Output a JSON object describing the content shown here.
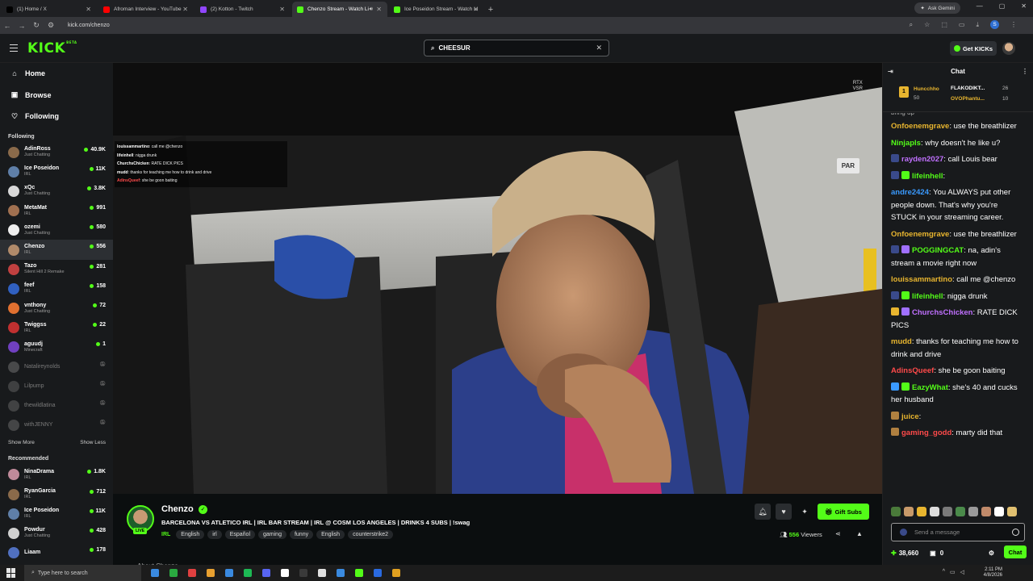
{
  "browser": {
    "tabs": [
      {
        "title": "(1) Home / X",
        "fav": "#000000"
      },
      {
        "title": "Afroman Interview - YouTube",
        "fav": "#ff0000"
      },
      {
        "title": "(2) Kotton - Twitch",
        "fav": "#9146ff"
      },
      {
        "title": "Chenzo Stream - Watch Li",
        "fav": "#53fc18",
        "active": true
      },
      {
        "title": "Ice Poseidon Stream - Watch Li",
        "fav": "#53fc18"
      }
    ],
    "ask_gemini": "Ask Gemini",
    "url": "kick.com/chenzo",
    "profile_initial": "S"
  },
  "header": {
    "logo": "KICK",
    "logo_sup": "BETA",
    "search_value": "CHEESUR",
    "get_kicks": "Get KICKs"
  },
  "sidebar": {
    "nav": [
      {
        "label": "Home",
        "icon": "home-icon",
        "glyph": "⌂"
      },
      {
        "label": "Browse",
        "icon": "browse-icon",
        "glyph": "▣"
      },
      {
        "label": "Following",
        "icon": "heart-icon",
        "glyph": "♡"
      }
    ],
    "following_heading": "Following",
    "following": [
      {
        "name": "AdinRoss",
        "cat": "Just Chatting",
        "viewers": "40.9K",
        "color": "#8a6a4a"
      },
      {
        "name": "Ice Poseidon",
        "cat": "IRL",
        "viewers": "11K",
        "color": "#5f7fa8"
      },
      {
        "name": "xQc",
        "cat": "Just Chatting",
        "viewers": "3.8K",
        "color": "#d8d8d8"
      },
      {
        "name": "MetaMat",
        "cat": "IRL",
        "viewers": "991",
        "color": "#a07050"
      },
      {
        "name": "ozemi",
        "cat": "Just Chatting",
        "viewers": "580",
        "color": "#eeeeee"
      },
      {
        "name": "Chenzo",
        "cat": "IRL",
        "viewers": "556",
        "color": "#b08a6a",
        "selected": true
      },
      {
        "name": "Tazo",
        "cat": "Silent Hill 2 Remake",
        "viewers": "281",
        "color": "#c04040"
      },
      {
        "name": "feef",
        "cat": "IRL",
        "viewers": "158",
        "color": "#3060c0"
      },
      {
        "name": "vnthony",
        "cat": "Just Chatting",
        "viewers": "72",
        "color": "#e07030"
      },
      {
        "name": "Twiggss",
        "cat": "IRL",
        "viewers": "22",
        "color": "#c03030"
      },
      {
        "name": "aguudj",
        "cat": "Minecraft",
        "viewers": "1",
        "color": "#7040c0"
      }
    ],
    "offline": [
      {
        "name": "Natalireynolds",
        "color": "#777777"
      },
      {
        "name": "Lilpump",
        "color": "#666666"
      },
      {
        "name": "thewildlatina",
        "color": "#6a6a6a"
      },
      {
        "name": "withJENNY",
        "color": "#707070"
      }
    ],
    "show_more": "Show More",
    "show_less": "Show Less",
    "recommended_heading": "Recommended",
    "recommended": [
      {
        "name": "NinaDrama",
        "cat": "IRL",
        "viewers": "1.8K",
        "color": "#c08a9a"
      },
      {
        "name": "RyanGarcia",
        "cat": "IRL",
        "viewers": "712",
        "color": "#8a6a4a"
      },
      {
        "name": "Ice Poseidon",
        "cat": "IRL",
        "viewers": "11K",
        "color": "#5f7fa8"
      },
      {
        "name": "Powdur",
        "cat": "Just Chatting",
        "viewers": "428",
        "color": "#d0d0d0"
      },
      {
        "name": "Liaam",
        "cat": "",
        "viewers": "178",
        "color": "#5070c0"
      }
    ]
  },
  "video": {
    "overlay_chat": [
      {
        "user": "louissammartino",
        "text": ": call me @chenzo",
        "color": "#ffffff"
      },
      {
        "user": "lifeinhell",
        "text": ": nigga drunk",
        "color": "#ffffff"
      },
      {
        "user": "ChurchsChicken",
        "text": ": RATE DICK PICS",
        "color": "#ffffff"
      },
      {
        "user": "mudd",
        "text": ": thanks for teaching me how to drink and drive",
        "color": "#ffffff"
      },
      {
        "user": "AdinsQueef",
        "text": ": she be goon baiting",
        "color": "#ff4a4a"
      }
    ],
    "rtx": "RTX",
    "vsr": "VSR",
    "park_sign": "PAR"
  },
  "stream": {
    "channel": "Chenzo",
    "live": "LIVE",
    "title": "BARCELONA VS ATLETICO IRL | IRL BAR STREAM | IRL @ COSM LOS ANGELES | DRINKS 4 SUBS | !swag",
    "category": "IRL",
    "tags": [
      "English",
      "irl",
      "Español",
      "gaming",
      "funny",
      "English",
      "counterstrike2"
    ],
    "gift_subs": "Gift Subs",
    "viewers_count": "556",
    "viewers_label": "Viewers",
    "about": "About Chenzo"
  },
  "chat": {
    "title": "Chat",
    "leaderboard": {
      "rank": "1",
      "first_name": "Huncchho",
      "first_val": "50",
      "second_name": "FLAKODIKT...",
      "second_val": "26",
      "third_name": "OVOPhantu...",
      "third_val": "10"
    },
    "messages": [
      {
        "user": "",
        "text": "bring up",
        "color": "#aaaaaa",
        "partial": true
      },
      {
        "user": "Onfoenemgrave",
        "text": ": use the breathlizer",
        "color": "#e8b52f"
      },
      {
        "user": "Ninjapls",
        "text": ": why doesn't he like u?",
        "color": "#53fc18"
      },
      {
        "user": "rayden2027",
        "text": ": call Louis bear",
        "color": "#c070ff",
        "badge": "#3a4a8a"
      },
      {
        "user": "lifeinhell",
        "text": ":",
        "color": "#53fc18",
        "badge": "#3a4a8a",
        "badge2": "#53fc18"
      },
      {
        "user": "andre2424",
        "text": ": You ALWAYS put other people down. That's why you're STUCK in your streaming career.",
        "color": "#3a9aff"
      },
      {
        "user": "Onfoenemgrave",
        "text": ": use the breathlizer",
        "color": "#e8b52f"
      },
      {
        "user": "POGGINGCAT",
        "text": ": na, adin's stream a movie right now",
        "color": "#53fc18",
        "badge": "#3a4a8a",
        "badge2": "#a070ff"
      },
      {
        "user": "louissammartino",
        "text": ": call me @chenzo",
        "color": "#e8b52f"
      },
      {
        "user": "lifeinhell",
        "text": ": nigga drunk",
        "color": "#53fc18",
        "badge": "#3a4a8a",
        "badge2": "#53fc18"
      },
      {
        "user": "ChurchsChicken",
        "text": ": RATE DICK PICS",
        "color": "#c070ff",
        "badge": "#e8b52f",
        "badge2": "#a070ff"
      },
      {
        "user": "mudd",
        "text": ": thanks for teaching me how to drink and drive",
        "color": "#e8b52f"
      },
      {
        "user": "AdinsQueef",
        "text": ": she be goon baiting",
        "color": "#ff4a4a"
      },
      {
        "user": "EazyWhat",
        "text": ": she's 40 and cucks her husband",
        "color": "#53fc18",
        "badge": "#3a9aff",
        "badge2": "#53fc18"
      },
      {
        "user": "juice",
        "text": ":",
        "color": "#e8b52f",
        "badge": "#b08040"
      },
      {
        "user": "gaming_godd",
        "text": ": marty did that",
        "color": "#ff4a4a",
        "badge": "#b08040"
      }
    ],
    "emote_colors": [
      "#4a7a3a",
      "#c89a6a",
      "#e8b52f",
      "#dddddd",
      "#7a7a7a",
      "#4a8a4a",
      "#9a9a9a",
      "#c08a6a",
      "#ffffff",
      "#e0c070"
    ],
    "input_placeholder": "Send a message",
    "points": "38,660",
    "gifts": "0",
    "send": "Chat"
  },
  "taskbar": {
    "search": "Type here to search",
    "time": "2:11 PM",
    "date": "4/8/2026",
    "app_colors": [
      "#3a8ae0",
      "#2aaa40",
      "#e04040",
      "#e8a030",
      "#3a8ae0",
      "#1db954",
      "#5865f2",
      "#ffffff",
      "#3a3a3a",
      "#e0e0e0",
      "#3a8ae0",
      "#53fc18",
      "#2a6ae0",
      "#e0a020"
    ]
  }
}
